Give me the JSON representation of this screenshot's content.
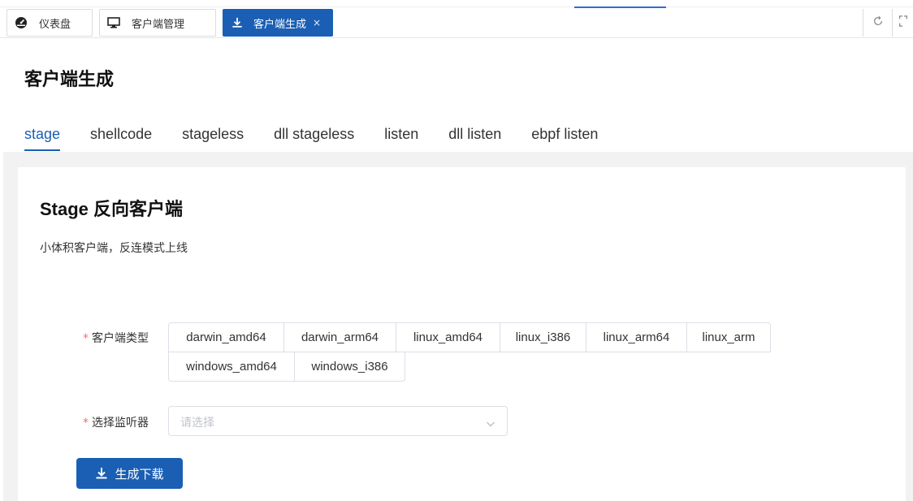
{
  "tabs": [
    {
      "label": "仪表盘",
      "icon": "dashboard-icon"
    },
    {
      "label": "客户端管理",
      "icon": "monitor-icon"
    },
    {
      "label": "客户端生成",
      "icon": "download-icon",
      "close": "×"
    }
  ],
  "page_title": "客户端生成",
  "subtabs": [
    "stage",
    "shellcode",
    "stageless",
    "dll stageless",
    "listen",
    "dll listen",
    "ebpf listen"
  ],
  "card": {
    "title": "Stage 反向客户端",
    "description": "小体积客户端，反连模式上线"
  },
  "form": {
    "required_mark": "*",
    "client_type_label": "客户端类型",
    "client_types": [
      "darwin_amd64",
      "darwin_arm64",
      "linux_amd64",
      "linux_i386",
      "linux_arm64",
      "linux_arm",
      "windows_amd64",
      "windows_i386"
    ],
    "listener_label": "选择监听器",
    "listener_placeholder": "请选择"
  },
  "generate_button": "生成下载",
  "colors": {
    "accent": "#1a5fb4",
    "required": "#f56c6c"
  }
}
